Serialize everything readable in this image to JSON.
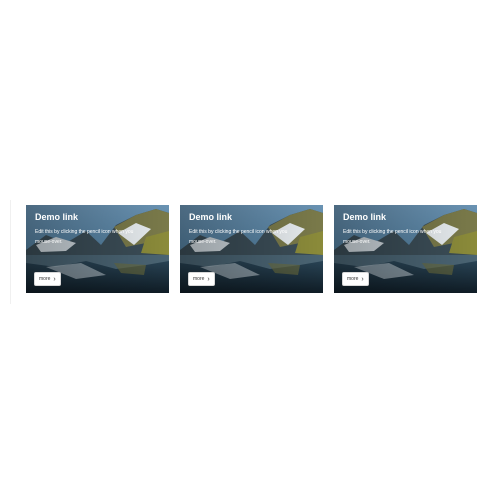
{
  "cards": [
    {
      "title": "Demo link",
      "description": "Edit this by clicking the pencil icon when you mouse-over.",
      "button_label": "more",
      "button_icon": "chevron-right-icon"
    },
    {
      "title": "Demo link",
      "description": "Edit this by clicking the pencil icon when you mouse-over.",
      "button_label": "more",
      "button_icon": "chevron-right-icon"
    },
    {
      "title": "Demo link",
      "description": "Edit this by clicking the pencil icon when you mouse-over.",
      "button_label": "more",
      "button_icon": "chevron-right-icon"
    }
  ],
  "colors": {
    "sky": "#3f6f8f",
    "water": "#142430",
    "snow": "#e7ecef",
    "grass": "#8b8b3a",
    "button_bg": "#ffffff"
  }
}
